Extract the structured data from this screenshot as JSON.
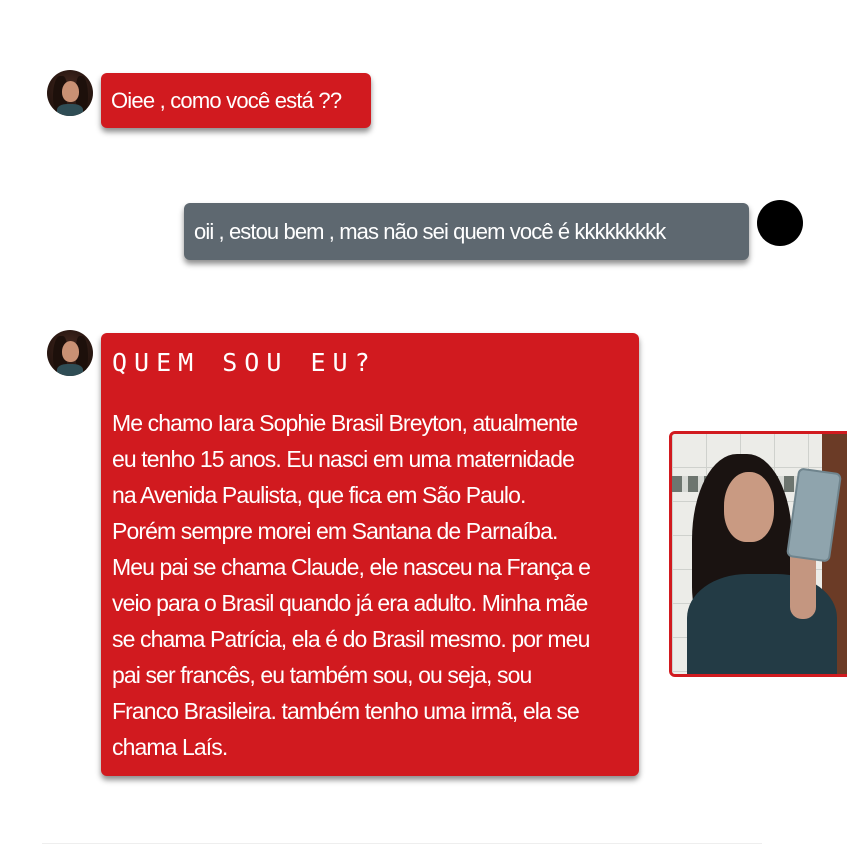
{
  "chat": {
    "messages": [
      {
        "text": "Oiee , como você está ??"
      },
      {
        "text": "oii , estou bem , mas não sei quem você é kkkkkkkkk"
      },
      {
        "title": "QUEM SOU EU?",
        "lines": [
          "Me chamo Iara Sophie Brasil Breyton, atualmente",
          "eu tenho 15 anos. Eu nasci em uma maternidade",
          "na Avenida Paulista, que fica em São Paulo.",
          "Porém sempre morei em Santana de Parnaíba.",
          "Meu pai se chama Claude, ele nasceu na França e",
          "veio para o Brasil quando já era adulto. Minha mãe",
          "se chama Patrícia, ela é do Brasil mesmo. por meu",
          "pai ser francês, eu também sou, ou seja, sou",
          "Franco Brasileira. também tenho uma irmã, ela se",
          "chama Laís."
        ]
      }
    ]
  },
  "colors": {
    "accent_red": "#d11a1f",
    "bubble_gray": "#5e6870"
  }
}
